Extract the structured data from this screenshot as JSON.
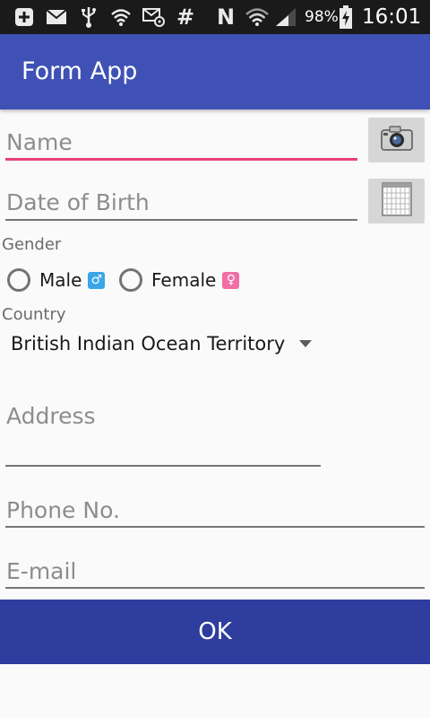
{
  "status_bar": {
    "battery": "98%",
    "time": "16:01",
    "icons": [
      "notification-plus-icon",
      "mail-icon",
      "usb-icon",
      "wifi-signal-icon",
      "email-at-icon",
      "hash-icon",
      "nfc-n-icon",
      "wifi-icon",
      "cell-signal-icon",
      "battery-charging-icon"
    ]
  },
  "app_bar": {
    "title": "Form App"
  },
  "form": {
    "name_placeholder": "Name",
    "name_value": "",
    "dob_placeholder": "Date of Birth",
    "dob_value": "",
    "gender_label": "Gender",
    "gender_options": [
      "Male",
      "Female"
    ],
    "gender_symbols": [
      "♂",
      "♀"
    ],
    "country_label": "Country",
    "country_selected": "British Indian Ocean Territory",
    "address_placeholder": "Address",
    "phone_placeholder": "Phone No.",
    "email_placeholder": "E-mail",
    "camera_icon": "camera-icon",
    "calendar_icon": "calendar-icon"
  },
  "ok_button": {
    "label": "OK"
  },
  "colors": {
    "app_bar": "#3f51b5",
    "ok_button": "#2f3d9e",
    "focus_underline": "#e6407a",
    "male_badge": "#3aa6e8",
    "female_badge": "#f06ea4"
  }
}
